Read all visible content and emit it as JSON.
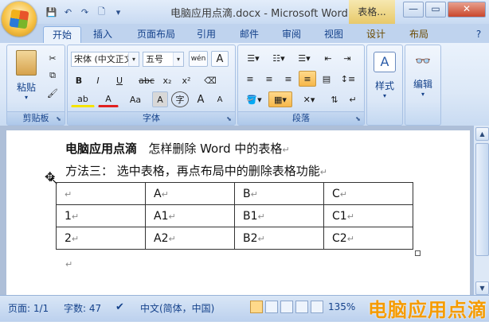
{
  "window": {
    "title": "电脑应用点滴.docx - Microsoft Word",
    "context_tab": "表格...",
    "controls": [
      "—",
      "▭",
      "✕"
    ]
  },
  "qat": {
    "icons": [
      "save-icon",
      "undo-icon",
      "redo-icon",
      "print-preview-icon",
      "customize-icon"
    ]
  },
  "tabs": [
    "开始",
    "插入",
    "页面布局",
    "引用",
    "邮件",
    "审阅",
    "视图",
    "设计",
    "布局"
  ],
  "active_tab": "开始",
  "ribbon": {
    "clipboard": {
      "label": "剪贴板",
      "paste_label": "粘贴"
    },
    "font": {
      "label": "字体",
      "font_name": "宋体 (中文正文",
      "font_size": "五号",
      "wen_label": "wén",
      "a_label": "A",
      "bold": "B",
      "italic": "I",
      "underline": "U",
      "strike": "abc",
      "subscript": "x₂",
      "superscript": "x²",
      "highlight": "ab",
      "font_color": "A",
      "case": "Aa",
      "char_shade": "A",
      "enclose": "字",
      "grow": "A",
      "shrink": "A"
    },
    "paragraph": {
      "label": "段落"
    },
    "styles": {
      "label": "样式"
    },
    "editing": {
      "label": "编辑"
    }
  },
  "document": {
    "line1_bold": "电脑应用点滴",
    "line1_rest": "怎样删除 Word 中的表格",
    "line2": "方法三：  选中表格，再点布局中的删除表格功能",
    "table": [
      [
        "",
        "A",
        "B",
        "C"
      ],
      [
        "1",
        "A1",
        "B1",
        "C1"
      ],
      [
        "2",
        "A2",
        "B2",
        "C2"
      ]
    ],
    "pilcrow": "↵"
  },
  "status": {
    "page": "页面: 1/1",
    "words": "字数: 47",
    "language": "中文(简体，中国)",
    "zoom": "135%"
  },
  "watermark": "电脑应用点滴"
}
